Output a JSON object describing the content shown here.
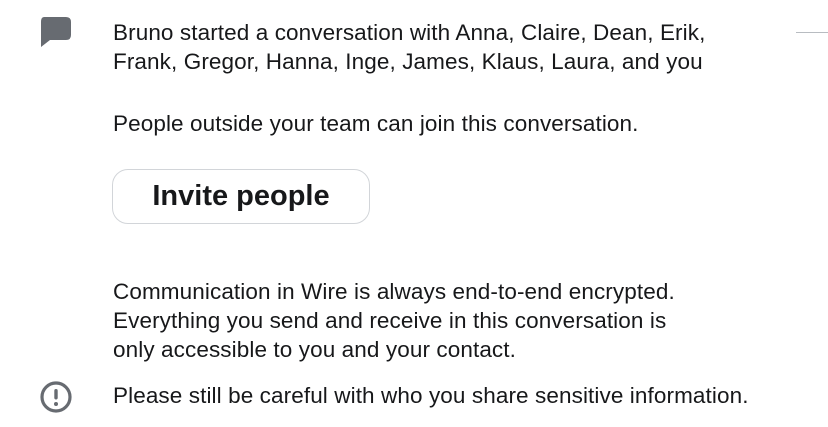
{
  "conversation_start": {
    "icon": "chat-bubble-icon",
    "line1": "Bruno started a conversation with Anna, Claire, Dean, Erik,",
    "line2": "Frank, Gregor, Hanna, Inge, James, Klaus, Laura, and you"
  },
  "guest_notice": {
    "text": "People outside your team can join this conversation."
  },
  "invite_button": {
    "label": "Invite people"
  },
  "encryption_notice": {
    "line1": "Communication in Wire is always end-to-end encrypted.",
    "line2": "Everything you send and receive in this conversation is",
    "line3": "only accessible to you and your contact."
  },
  "warning_notice": {
    "icon": "exclamation-circle-icon",
    "text": "Please still be careful with who you share sensitive information."
  },
  "colors": {
    "text": "#17181a",
    "icon": "#676b71",
    "button_border": "#d2d5d9",
    "background": "#ffffff"
  }
}
